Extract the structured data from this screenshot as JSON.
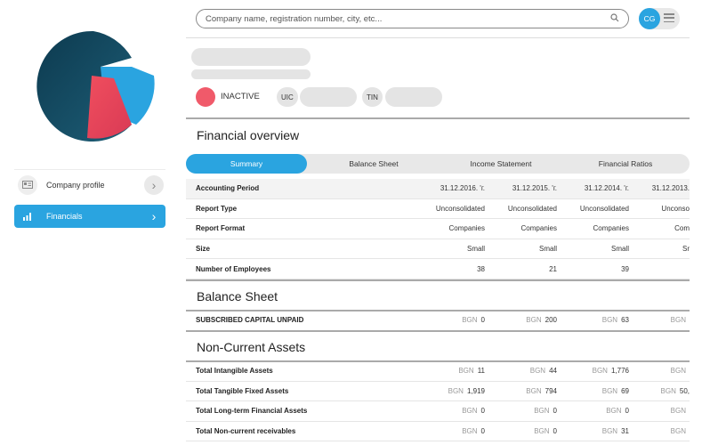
{
  "search": {
    "placeholder": "Company name, registration number, city, etc..."
  },
  "user": {
    "initials": "CG"
  },
  "sidebar": {
    "items": [
      {
        "label": "Company profile",
        "icon": "id-card-icon",
        "active": false
      },
      {
        "label": "Financials",
        "icon": "bar-chart-icon",
        "active": true
      }
    ]
  },
  "company": {
    "status": "INACTIVE",
    "status_color": "#f05a6a",
    "uic_label": "UIC",
    "tin_label": "TIN"
  },
  "financial_overview": {
    "title": "Financial overview",
    "tabs": [
      "Summary",
      "Balance Sheet",
      "Income Statement",
      "Financial Ratios"
    ],
    "active_tab": "Summary",
    "rows": [
      {
        "label": "Accounting Period",
        "values": [
          "31.12.2016. 'г.",
          "31.12.2015. 'г.",
          "31.12.2014. 'г.",
          "31.12.2013."
        ]
      },
      {
        "label": "Report Type",
        "values": [
          "Unconsolidated",
          "Unconsolidated",
          "Unconsolidated",
          "Unconso"
        ]
      },
      {
        "label": "Report Format",
        "values": [
          "Companies",
          "Companies",
          "Companies",
          "Com"
        ]
      },
      {
        "label": "Size",
        "values": [
          "Small",
          "Small",
          "Small",
          "Sr"
        ]
      },
      {
        "label": "Number of Employees",
        "values": [
          "38",
          "21",
          "39",
          ""
        ]
      }
    ]
  },
  "balance_sheet": {
    "title": "Balance Sheet",
    "rows": [
      {
        "label": "SUBSCRIBED CAPITAL UNPAID",
        "currency": "BGN",
        "values": [
          "0",
          "200",
          "63",
          ""
        ]
      }
    ]
  },
  "non_current_assets": {
    "title": "Non-Current Assets",
    "rows": [
      {
        "label": "Total Intangible Assets",
        "currency": "BGN",
        "values": [
          "11",
          "44",
          "1,776",
          ""
        ]
      },
      {
        "label": "Total Tangible Fixed Assets",
        "currency": "BGN",
        "values": [
          "1,919",
          "794",
          "69",
          "50,"
        ]
      },
      {
        "label": "Total Long-term Financial Assets",
        "currency": "BGN",
        "values": [
          "0",
          "0",
          "0",
          ""
        ]
      },
      {
        "label": "Total Non-current receivables",
        "currency": "BGN",
        "values": [
          "0",
          "0",
          "31",
          ""
        ]
      }
    ]
  },
  "colors": {
    "accent": "#2aa4e0",
    "inactive": "#f05a6a",
    "logo_dark": "#0f3d52"
  }
}
